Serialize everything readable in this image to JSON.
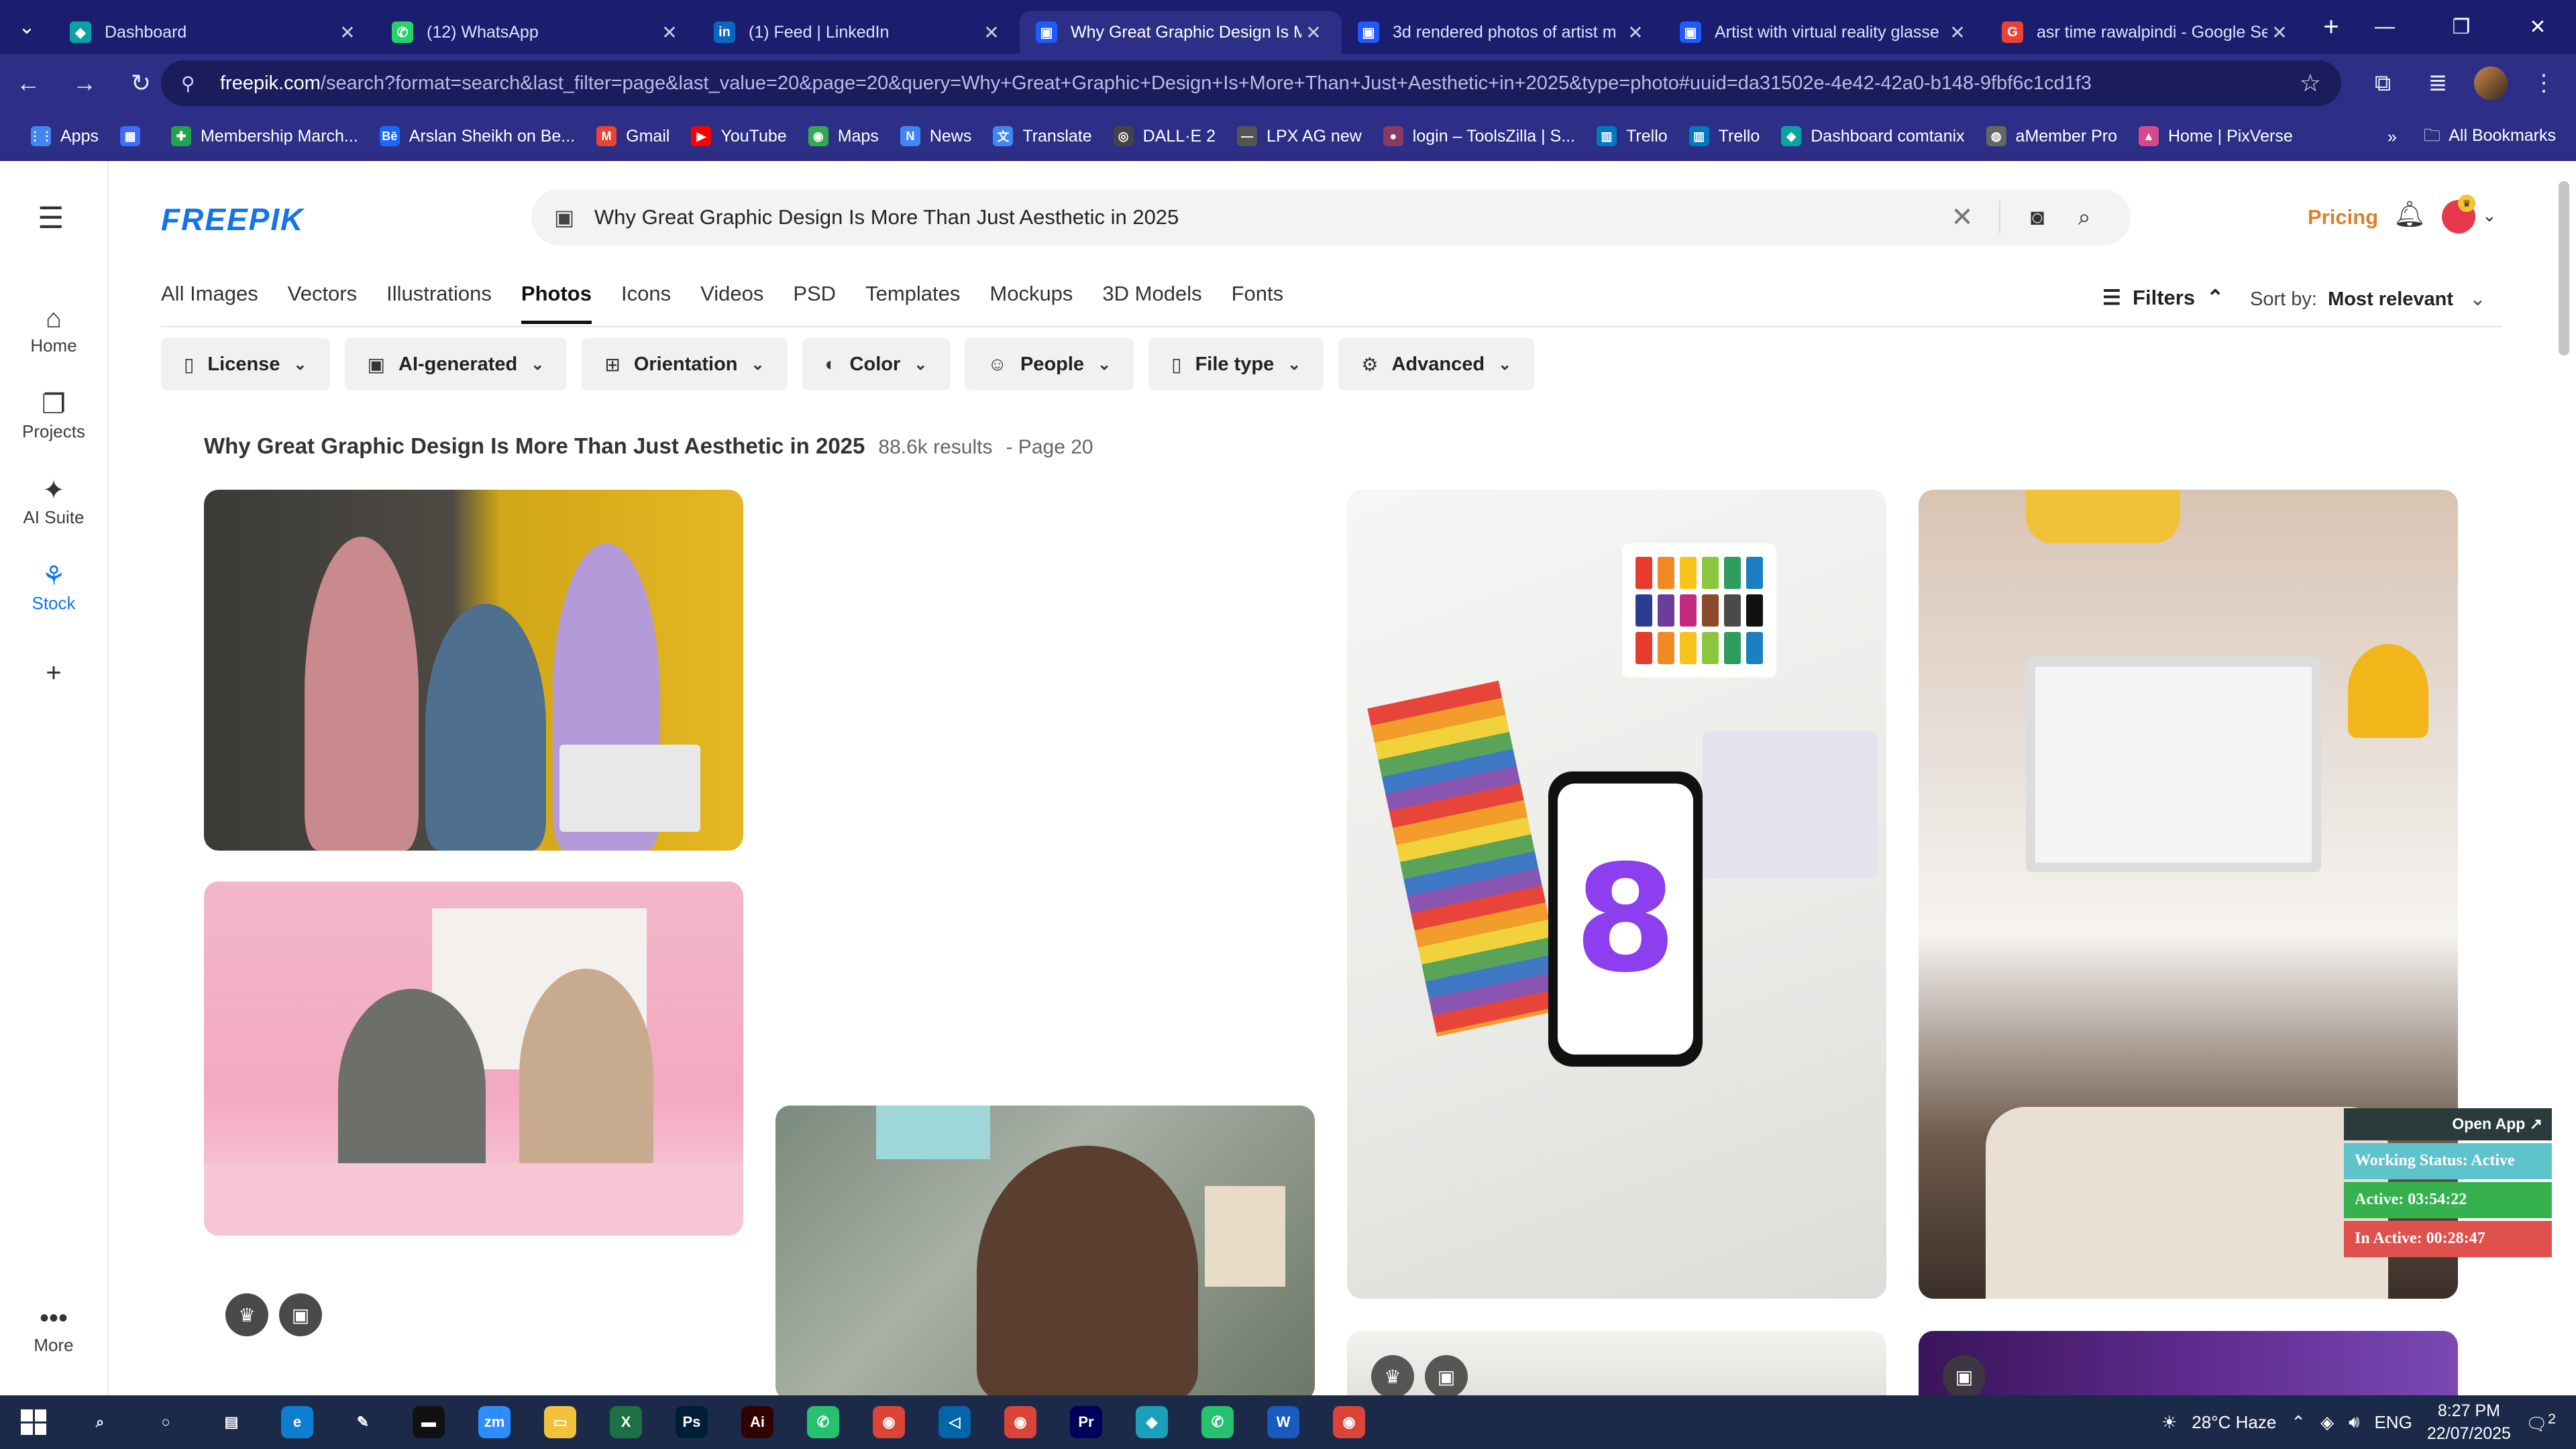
{
  "browser": {
    "tabs": [
      {
        "title": "Dashboard",
        "fav_color": "#0aa3a3",
        "fav_glyph": "◆",
        "active": false
      },
      {
        "title": "(12) WhatsApp",
        "fav_color": "#25d366",
        "fav_glyph": "✆",
        "active": false
      },
      {
        "title": "(1) Feed | LinkedIn",
        "fav_color": "#0a66c2",
        "fav_glyph": "in",
        "active": false
      },
      {
        "title": "Why Great Graphic Design Is M",
        "fav_color": "#1e5bff",
        "fav_glyph": "▣",
        "active": true
      },
      {
        "title": "3d rendered photos of artist m",
        "fav_color": "#1e5bff",
        "fav_glyph": "▣",
        "active": false
      },
      {
        "title": "Artist with virtual reality glasse",
        "fav_color": "#1e5bff",
        "fav_glyph": "▣",
        "active": false
      },
      {
        "title": "asr time rawalpindi - Google Se",
        "fav_color": "#ea4335",
        "fav_glyph": "G",
        "active": false
      }
    ],
    "new_tab_glyph": "+",
    "url_host": "freepik.com",
    "url_path": "/search?format=search&last_filter=page&last_value=20&page=20&query=Why+Great+Graphic+Design+Is+More+Than+Just+Aesthetic+in+2025&type=photo#uuid=da31502e-4e42-42a0-b148-9fbf6c1cd1f3",
    "bookmarks": [
      {
        "label": "Apps",
        "color": "#4285f4",
        "glyph": "⋮⋮"
      },
      {
        "label": "",
        "color": "#3b6cff",
        "glyph": "▦"
      },
      {
        "label": "Membership March...",
        "color": "#22a34a",
        "glyph": "✚"
      },
      {
        "label": "Arslan Sheikh on Be...",
        "color": "#1769ff",
        "glyph": "Bē"
      },
      {
        "label": "Gmail",
        "color": "#ea4335",
        "glyph": "M"
      },
      {
        "label": "YouTube",
        "color": "#ff0000",
        "glyph": "▶"
      },
      {
        "label": "Maps",
        "color": "#34a853",
        "glyph": "◉"
      },
      {
        "label": "News",
        "color": "#4285f4",
        "glyph": "N"
      },
      {
        "label": "Translate",
        "color": "#4285f4",
        "glyph": "文"
      },
      {
        "label": "DALL·E 2",
        "color": "#444444",
        "glyph": "◎"
      },
      {
        "label": "LPX AG new",
        "color": "#555555",
        "glyph": "—"
      },
      {
        "label": "login – ToolsZilla | S...",
        "color": "#8b3a62",
        "glyph": "●"
      },
      {
        "label": "Trello",
        "color": "#0079bf",
        "glyph": "▥"
      },
      {
        "label": "Trello",
        "color": "#0079bf",
        "glyph": "▥"
      },
      {
        "label": "Dashboard comtanix",
        "color": "#0aa3a3",
        "glyph": "◆"
      },
      {
        "label": "aMember Pro",
        "color": "#666666",
        "glyph": "◍"
      },
      {
        "label": "Home | PixVerse",
        "color": "#d9478f",
        "glyph": "▲"
      }
    ],
    "all_bookmarks": "All Bookmarks"
  },
  "rail": {
    "items": [
      {
        "label": "Home",
        "icon": "⌂"
      },
      {
        "label": "Projects",
        "icon": "❐"
      },
      {
        "label": "AI Suite",
        "icon": "✦"
      },
      {
        "label": "Stock",
        "icon": "⚘"
      }
    ],
    "add_glyph": "+",
    "more_label": "More",
    "more_glyph": "•••"
  },
  "header": {
    "logo": "FREEPIK",
    "search_value": "Why Great Graphic Design Is More Than Just Aesthetic in 2025",
    "pricing": "Pricing"
  },
  "categories": [
    "All Images",
    "Vectors",
    "Illustrations",
    "Photos",
    "Icons",
    "Videos",
    "PSD",
    "Templates",
    "Mockups",
    "3D Models",
    "Fonts"
  ],
  "active_category": "Photos",
  "filters_label": "Filters",
  "sort": {
    "label": "Sort by:",
    "value": "Most relevant"
  },
  "chips": [
    {
      "label": "License",
      "icon": "▯"
    },
    {
      "label": "AI-generated",
      "icon": "▣"
    },
    {
      "label": "Orientation",
      "icon": "⊞"
    },
    {
      "label": "Color",
      "icon": "◐"
    },
    {
      "label": "People",
      "icon": "☺"
    },
    {
      "label": "File type",
      "icon": "▯"
    },
    {
      "label": "Advanced",
      "icon": "⚙"
    }
  ],
  "results": {
    "title": "Why Great Graphic Design Is More Than Just Aesthetic in 2025",
    "count": "88.6k results",
    "page": "- Page 20"
  },
  "working_status": {
    "open_app": "Open App ↗",
    "status": "Working Status: Active",
    "active": "Active: 03:54:22",
    "inactive": "In Active: 00:28:47"
  },
  "taskbar": {
    "apps": [
      {
        "name": "search",
        "color": "transparent",
        "glyph": "⌕"
      },
      {
        "name": "cortana",
        "color": "transparent",
        "glyph": "○"
      },
      {
        "name": "task-view",
        "color": "transparent",
        "glyph": "▤"
      },
      {
        "name": "edge",
        "color": "#0c7fd1",
        "glyph": "e"
      },
      {
        "name": "pen",
        "color": "transparent",
        "glyph": "✎"
      },
      {
        "name": "terminal",
        "color": "#111111",
        "glyph": "▬"
      },
      {
        "name": "zoom",
        "color": "#2d8cff",
        "glyph": "zm"
      },
      {
        "name": "explorer",
        "color": "#f3c23d",
        "glyph": "▭"
      },
      {
        "name": "excel",
        "color": "#1d7044",
        "glyph": "X"
      },
      {
        "name": "photoshop",
        "color": "#001e36",
        "glyph": "Ps"
      },
      {
        "name": "illustrator",
        "color": "#330000",
        "glyph": "Ai"
      },
      {
        "name": "phone-link",
        "color": "#25c16f",
        "glyph": "✆"
      },
      {
        "name": "chrome",
        "color": "#db4437",
        "glyph": "◉"
      },
      {
        "name": "vscode",
        "color": "#0065a9",
        "glyph": "◁"
      },
      {
        "name": "chrome-active",
        "color": "#db4437",
        "glyph": "◉"
      },
      {
        "name": "premiere",
        "color": "#00005b",
        "glyph": "Pr"
      },
      {
        "name": "app-diamond",
        "color": "#1c9fb8",
        "glyph": "◆"
      },
      {
        "name": "phone-link-2",
        "color": "#25c16f",
        "glyph": "✆"
      },
      {
        "name": "word",
        "color": "#185abd",
        "glyph": "W"
      },
      {
        "name": "chrome-2",
        "color": "#db4437",
        "glyph": "◉"
      }
    ],
    "weather": "28°C Haze",
    "lang": "ENG",
    "time": "8:27 PM",
    "date": "22/07/2025",
    "notif_count": "2"
  },
  "colors": {
    "brand": "#1273eb",
    "pricing": "#d9822b",
    "chrome_bg": "#2d2f86"
  }
}
